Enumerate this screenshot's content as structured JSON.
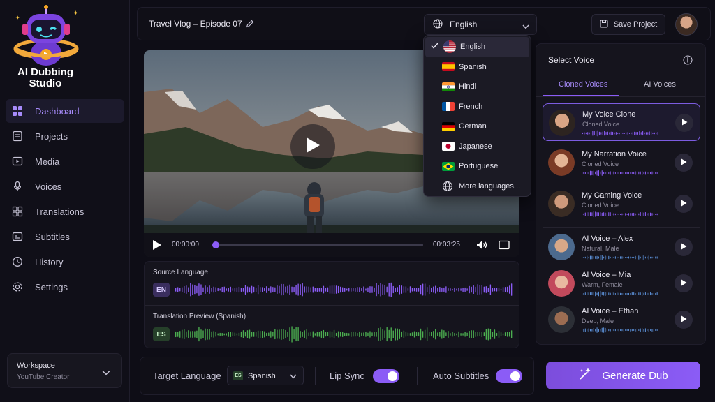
{
  "app": {
    "name": "AI Dubbing Studio"
  },
  "sidebar": {
    "items": [
      {
        "label": "Dashboard",
        "icon": "grid-icon",
        "active": true
      },
      {
        "label": "Projects",
        "icon": "document-icon",
        "active": false
      },
      {
        "label": "Media",
        "icon": "video-icon",
        "active": false
      },
      {
        "label": "Voices",
        "icon": "microphone-icon",
        "active": false
      },
      {
        "label": "Translations",
        "icon": "translate-icon",
        "active": false
      },
      {
        "label": "Subtitles",
        "icon": "subtitles-icon",
        "active": false
      },
      {
        "label": "History",
        "icon": "clock-icon",
        "active": false
      },
      {
        "label": "Settings",
        "icon": "gear-icon",
        "active": false
      }
    ],
    "workspace": {
      "title": "Workspace",
      "value": "YouTube Creator"
    }
  },
  "topbar": {
    "project_title": "Travel Vlog – Episode 07",
    "language_selected": "English",
    "save_label": "Save Project"
  },
  "language_dropdown": {
    "options": [
      {
        "label": "English",
        "flag": "us",
        "selected": true
      },
      {
        "label": "Spanish",
        "flag": "es",
        "selected": false
      },
      {
        "label": "Hindi",
        "flag": "in",
        "selected": false
      },
      {
        "label": "French",
        "flag": "fr",
        "selected": false
      },
      {
        "label": "German",
        "flag": "de",
        "selected": false
      },
      {
        "label": "Japanese",
        "flag": "jp",
        "selected": false
      },
      {
        "label": "Portuguese",
        "flag": "br",
        "selected": false
      },
      {
        "label": "More languages...",
        "flag": "globe",
        "selected": false
      }
    ]
  },
  "player": {
    "current_time": "00:00:00",
    "duration": "00:03:25",
    "progress": 0.0
  },
  "waveforms": {
    "source_label": "Source Language",
    "source_badge": "EN",
    "translation_label": "Translation Preview (Spanish)",
    "translation_badge": "ES"
  },
  "voice_panel": {
    "title": "Select Voice",
    "tabs": [
      {
        "label": "Cloned Voices",
        "active": true
      },
      {
        "label": "AI Voices",
        "active": false
      }
    ],
    "voices": [
      {
        "name": "My Voice Clone",
        "desc": "Cloned Voice",
        "selected": true
      },
      {
        "name": "My Narration Voice",
        "desc": "Cloned Voice",
        "selected": false
      },
      {
        "name": "My Gaming Voice",
        "desc": "Cloned Voice",
        "selected": false
      },
      {
        "name": "AI Voice – Alex",
        "desc": "Natural, Male",
        "selected": false
      },
      {
        "name": "AI Voice – Mia",
        "desc": "Warm, Female",
        "selected": false
      },
      {
        "name": "AI Voice – Ethan",
        "desc": "Deep, Male",
        "selected": false
      }
    ]
  },
  "bottombar": {
    "target_language_label": "Target Language",
    "target_language_badge": "ES",
    "target_language_value": "Spanish",
    "lip_sync_label": "Lip Sync",
    "lip_sync_on": true,
    "auto_subtitles_label": "Auto Subtitles",
    "auto_subtitles_on": true,
    "generate_label": "Generate Dub"
  },
  "colors": {
    "accent": "#8b5cf6",
    "accent_text": "#a78bfa",
    "source_wave": "#8b5cf6",
    "translation_wave": "#4caf50",
    "background": "#0e0d16"
  }
}
